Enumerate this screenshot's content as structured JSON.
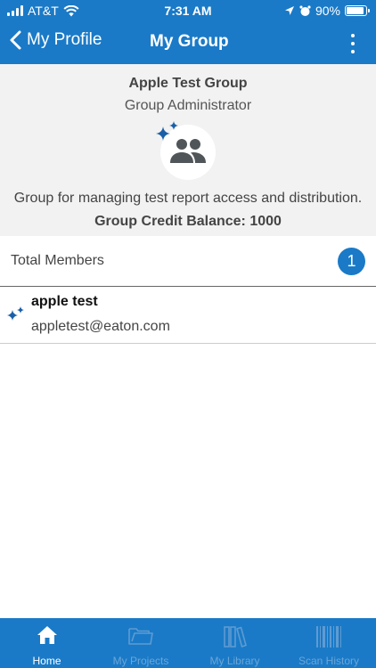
{
  "status_bar": {
    "carrier": "AT&T",
    "time": "7:31 AM",
    "battery": "90%",
    "battery_level": 0.9
  },
  "nav": {
    "back_label": "My Profile",
    "title": "My Group"
  },
  "group": {
    "name": "Apple Test Group",
    "role": "Group Administrator",
    "description": "Group for managing test report access and distribution.",
    "credit_balance": "Group Credit Balance: 1000"
  },
  "members": {
    "label": "Total Members",
    "count": "1",
    "items": [
      {
        "name": "apple test",
        "email": "appletest@eaton.com"
      }
    ]
  },
  "tabs": [
    {
      "label": "Home",
      "icon": "home-icon",
      "active": true
    },
    {
      "label": "My Projects",
      "icon": "folder-icon",
      "active": false
    },
    {
      "label": "My Library",
      "icon": "books-icon",
      "active": false
    },
    {
      "label": "Scan History",
      "icon": "barcode-icon",
      "active": false
    }
  ],
  "colors": {
    "accent": "#1a7ac7",
    "inactive_tab": "#6aa6d8",
    "header_bg": "#f2f2f2"
  }
}
